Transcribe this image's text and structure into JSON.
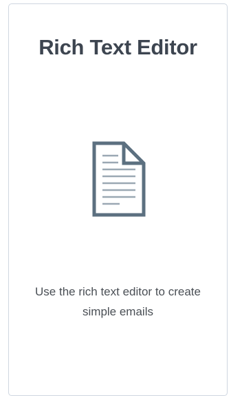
{
  "card": {
    "title": "Rich Text Editor",
    "icon": "document-icon",
    "description": "Use the rich text editor to create simple emails"
  },
  "colors": {
    "title": "#3d4550",
    "icon": "#5c7080",
    "icon_lines": "#9aa8b3",
    "border": "#cfd6e0"
  }
}
